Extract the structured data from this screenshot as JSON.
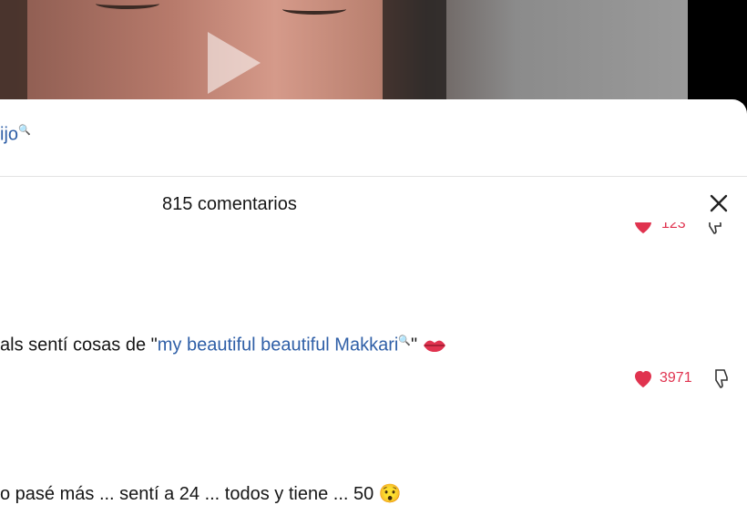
{
  "top_link": {
    "text": "ijo"
  },
  "comments_header": {
    "title": "815 comentarios"
  },
  "partial_comment": {
    "likes": "123"
  },
  "comment": {
    "text_before": "als sentí cosas de \"",
    "link_text": "my beautiful beautiful Makkari",
    "text_after": "\" ",
    "likes": "3971"
  },
  "bottom_comment": {
    "text": "o pasé más ... sentí a 24 ... todos y tiene ... 50 😯"
  },
  "colors": {
    "accent_link": "#2f5fa7",
    "like_red": "#e0334f"
  },
  "icons": [
    "play-icon",
    "search-icon",
    "close-icon",
    "heart-icon",
    "dislike-icon",
    "lips-icon"
  ]
}
